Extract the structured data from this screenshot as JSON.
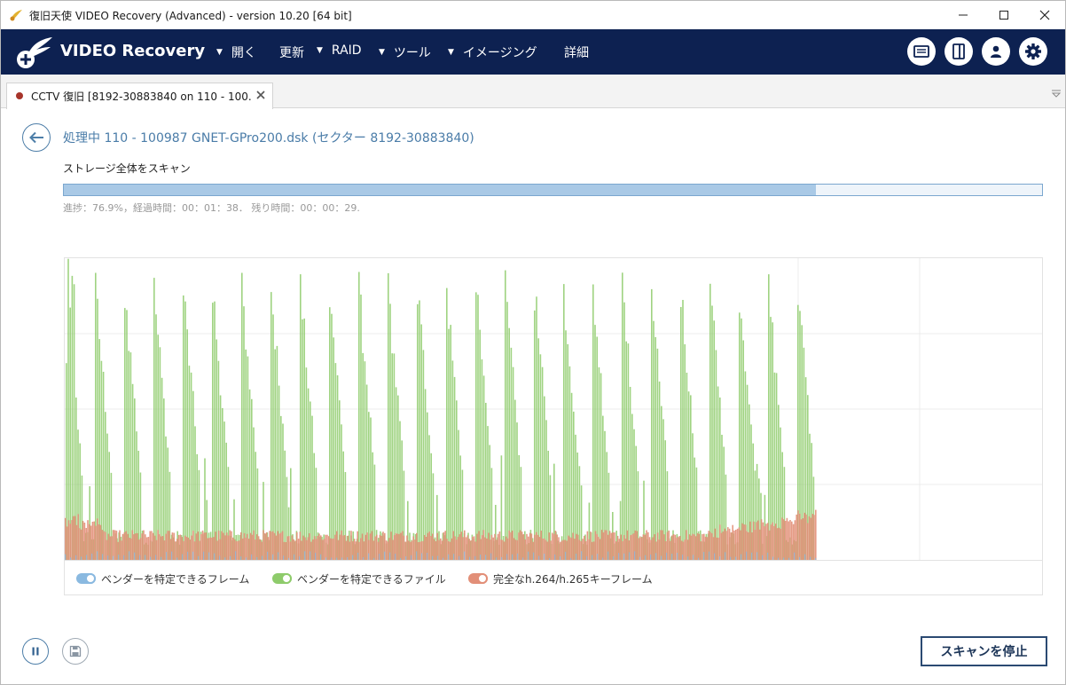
{
  "window": {
    "title": "復旧天使 VIDEO Recovery (Advanced) - version 10.20 [64 bit]"
  },
  "header": {
    "brand": "VIDEO Recovery",
    "menu": [
      {
        "label": "開く",
        "caret": true
      },
      {
        "label": "更新",
        "caret": false
      },
      {
        "label": "RAID",
        "caret": true
      },
      {
        "label": "ツール",
        "caret": true
      },
      {
        "label": "イメージング",
        "caret": true
      },
      {
        "label": "詳細",
        "caret": false
      }
    ],
    "icons": [
      "message-icon",
      "panel-icon",
      "user-icon",
      "gear-icon"
    ]
  },
  "tab": {
    "label": "CCTV 復旧 [8192-30883840 on 110 - 100..."
  },
  "scan": {
    "title": "処理中 110 - 100987 GNET-GPro200.dsk (セクター 8192-30883840)",
    "subtitle": "ストレージ全体をスキャン",
    "progress_fraction": 0.769,
    "status": "進捗：76.9%，経過時間：00：01：38．  残り時間：00：00：29."
  },
  "chart_data": {
    "type": "bar",
    "x_progress_fraction": 0.769,
    "grid": true,
    "legend_placement": "bottom",
    "series": [
      {
        "name": "ベンダーを特定できるフレーム",
        "color": "#8ab9e0",
        "pattern": "low, near baseline"
      },
      {
        "name": "ベンダーを特定できるファイル",
        "color": "#8ecb6b",
        "pattern": "periodic tall spikes, about 26 peaks"
      },
      {
        "name": "完全なh.264/h.265キーフレーム",
        "color": "#e28f78",
        "pattern": "dense band at roughly 10% height"
      }
    ]
  },
  "legend": [
    {
      "label": "ベンダーを特定できるフレーム",
      "color": "#8ab9e0"
    },
    {
      "label": "ベンダーを特定できるファイル",
      "color": "#8ecb6b"
    },
    {
      "label": "完全なh.264/h.265キーフレーム",
      "color": "#e28f78"
    }
  ],
  "buttons": {
    "stop": "スキャンを停止"
  }
}
